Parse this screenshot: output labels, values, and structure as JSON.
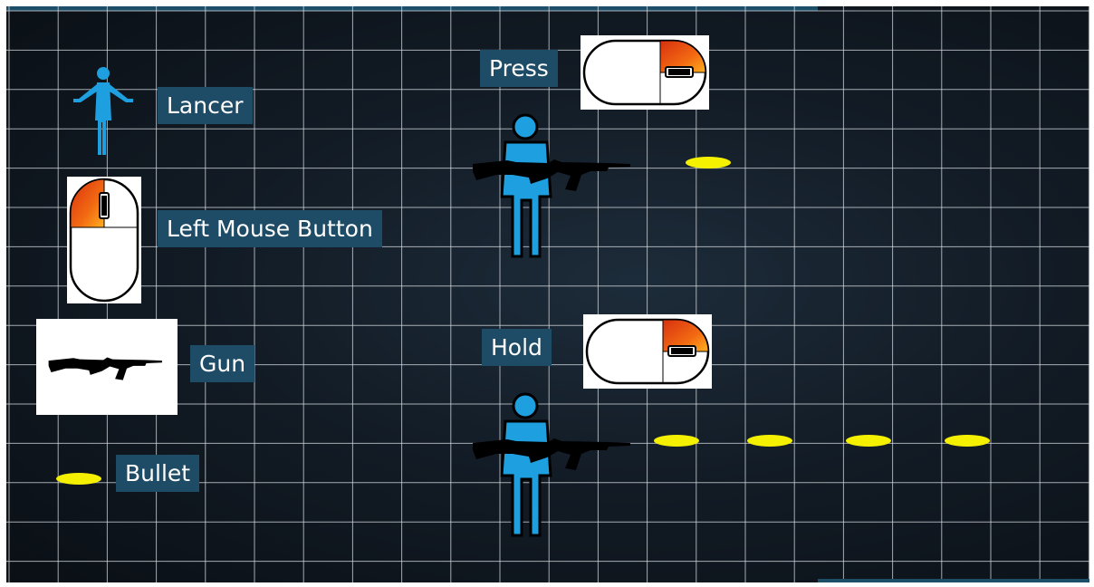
{
  "legend": {
    "lancer": "Lancer",
    "left_mouse_button": "Left Mouse Button",
    "gun": "Gun",
    "bullet": "Bullet"
  },
  "demo": {
    "press_label": "Press",
    "hold_label": "Hold",
    "press_bullets": 1,
    "hold_bullets": 4
  },
  "colors": {
    "label_bg": "#1e4b65",
    "figure": "#1ea0e0",
    "bullet": "#f4f000",
    "mouse_button": "#f06010",
    "grid": "#d8dde2"
  },
  "icons": [
    "person-icon",
    "mouse-icon",
    "rifle-icon",
    "bullet-icon"
  ]
}
